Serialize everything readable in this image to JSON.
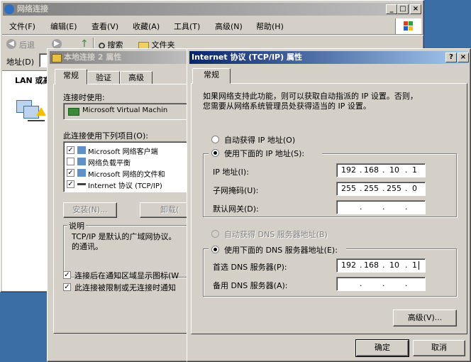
{
  "explorer": {
    "title": "网络连接",
    "menu": [
      "文件(F)",
      "编辑(E)",
      "查看(V)",
      "收藏(A)",
      "工具(T)",
      "高级(N)",
      "帮助(H)"
    ],
    "back": "后退",
    "search": "搜索",
    "folders": "文件夹",
    "address_label": "地址(D)",
    "lan_label": "LAN 或高"
  },
  "conn_props": {
    "title": "本地连接 2 属性",
    "tabs": [
      "常规",
      "验证",
      "高级"
    ],
    "connect_using_label": "连接时使用:",
    "adapter": "Microsoft Virtual Machin",
    "items_label": "此连接使用下列项目(O):",
    "items": [
      {
        "label": "Microsoft 网络客户端",
        "checked": true
      },
      {
        "label": "网络负载平衡",
        "checked": false
      },
      {
        "label": "Microsoft 网络的文件和",
        "checked": true
      },
      {
        "label": "Internet 协议 (TCP/IP)",
        "checked": true
      }
    ],
    "install_button": "安装(N)...",
    "uninstall_button": "卸载(",
    "description_title": "说明",
    "description_text_1": "TCP/IP 是默认的广域网协议。",
    "description_text_2": "的通讯。",
    "show_icon_label": "连接后在通知区域显示图标(W",
    "notify_label": "此连接被限制或无连接时通知"
  },
  "tcpip": {
    "title": "Internet 协议 (TCP/IP) 属性",
    "tab": "常规",
    "intro_1": "如果网络支持此功能，则可以获取自动指派的 IP 设置。否则，",
    "intro_2": "您需要从网络系统管理员处获得适当的 IP 设置。",
    "auto_ip": "自动获得 IP 地址(O)",
    "use_ip": "使用下面的 IP 地址(S):",
    "ip_label": "IP 地址(I):",
    "ip": [
      "192",
      "168",
      "10",
      "1"
    ],
    "mask_label": "子网掩码(U):",
    "mask": [
      "255",
      "255",
      "255",
      "0"
    ],
    "gateway_label": "默认网关(D):",
    "auto_dns": "自动获得 DNS 服务器地址(B)",
    "use_dns": "使用下面的 DNS 服务器地址(E):",
    "pref_dns_label": "首选 DNS 服务器(P):",
    "pref_dns": [
      "192",
      "168",
      "10",
      "1"
    ],
    "alt_dns_label": "备用 DNS 服务器(A):",
    "advanced_button": "高级(V)...",
    "ok_button": "确定",
    "cancel_button": "取消",
    "help_glyph": "?",
    "close_glyph": "×"
  }
}
